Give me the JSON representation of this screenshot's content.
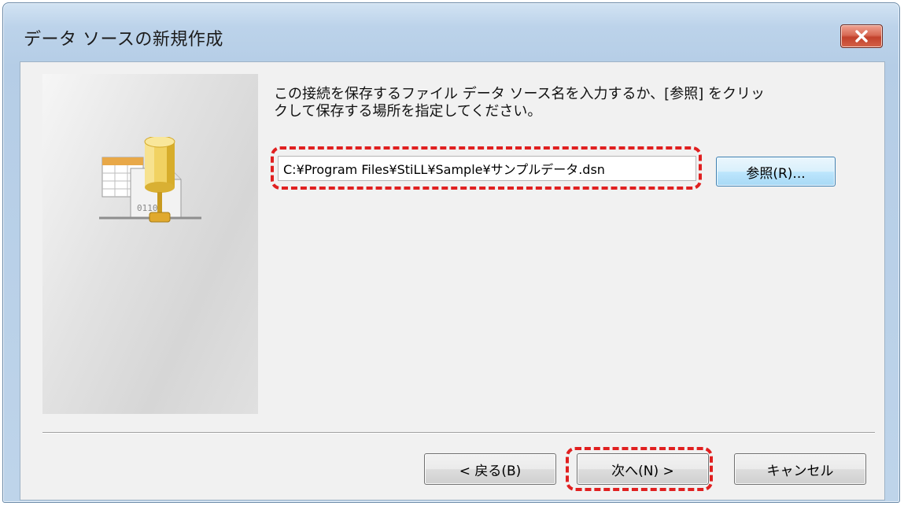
{
  "window": {
    "title": "データ ソースの新規作成"
  },
  "content": {
    "instruction_line1": "この接続を保存するファイル データ ソース名を入力するか、[参照] をクリッ",
    "instruction_line2": "クして保存する場所を指定してください。",
    "path_value": "C:¥Program Files¥StiLL¥Sample¥サンプルデータ.dsn",
    "browse_label": "参照(R)..."
  },
  "footer": {
    "back_label": "< 戻る(B)",
    "next_label": "次へ(N) >",
    "cancel_label": "キャンセル"
  },
  "colors": {
    "annotation": "#e02020",
    "title_bar": "#bcd3ea",
    "close_button": "#c2412b",
    "focused_button": "#bee6fd"
  },
  "icons": {
    "close": "close-icon",
    "data_source": "database-file-icon"
  }
}
